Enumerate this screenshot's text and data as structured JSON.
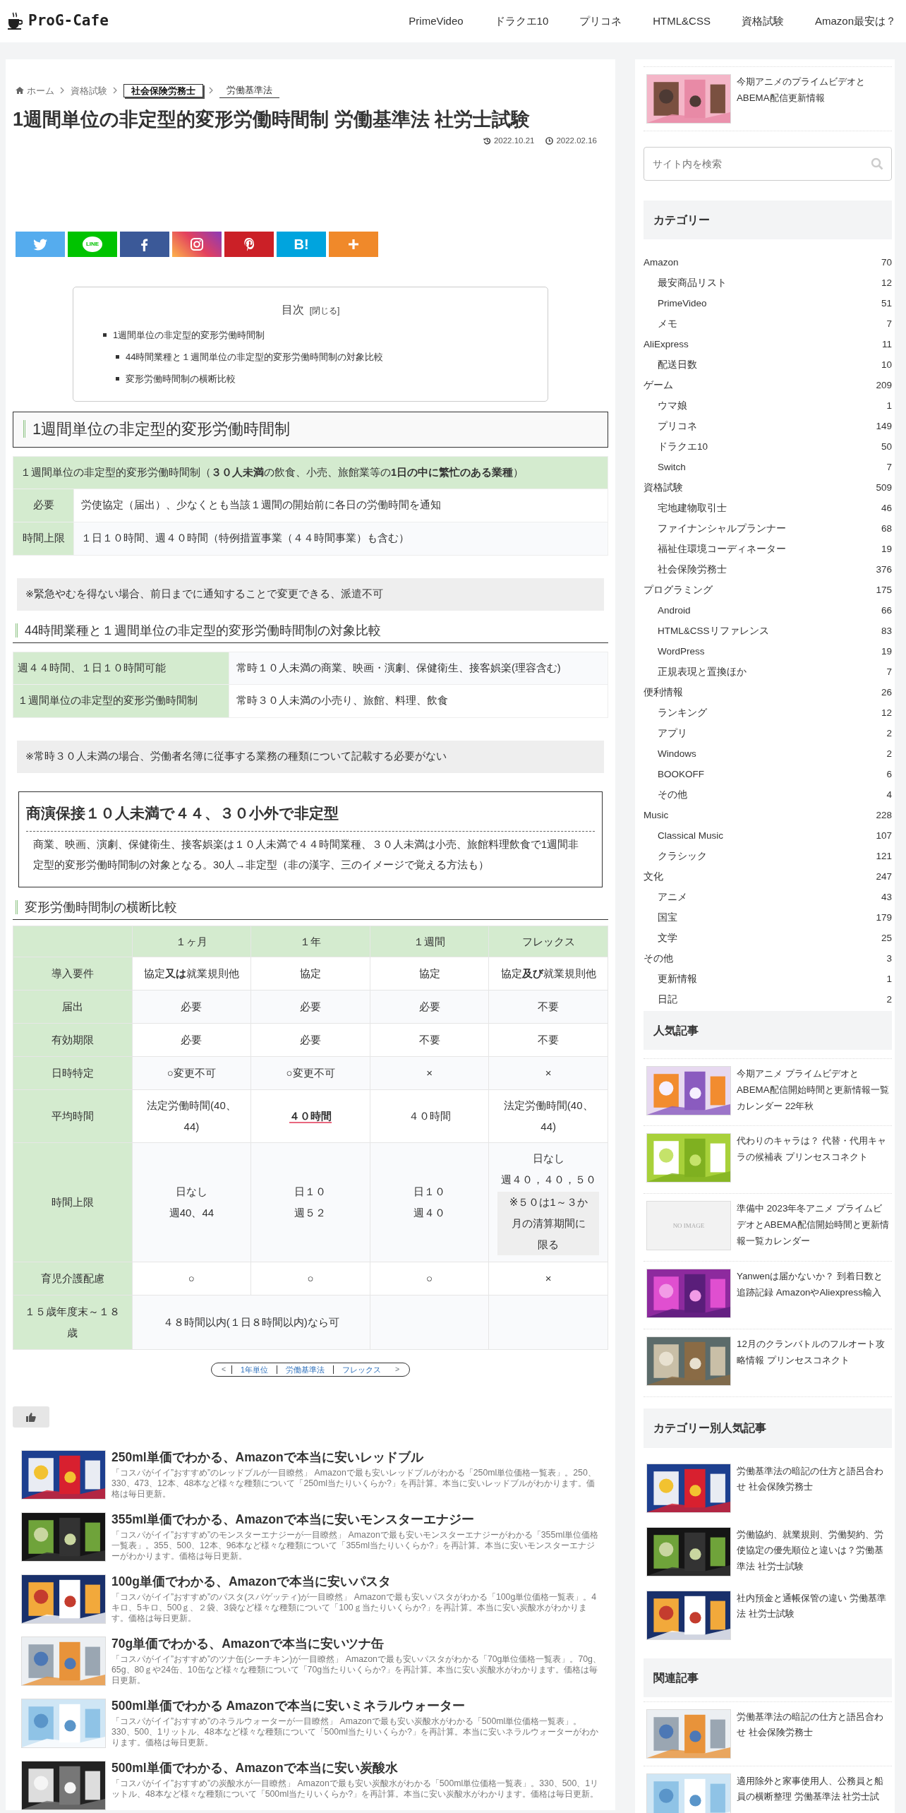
{
  "site": {
    "logo": "ProG-Cafe"
  },
  "nav": [
    "PrimeVideo",
    "ドラクエ10",
    "プリコネ",
    "HTML&CSS",
    "資格試験",
    "Amazon最安は？"
  ],
  "breadcrumb": [
    {
      "label": "ホーム",
      "kind": "home"
    },
    {
      "label": "資格試験",
      "kind": "link"
    },
    {
      "label": "社会保険労務士",
      "kind": "boxed"
    },
    {
      "label": "労働基準法",
      "kind": "underlined"
    }
  ],
  "article": {
    "title": "1週間単位の非定型的変形労働時間制 労働基準法 社労士試験",
    "updated": "2022.10.21",
    "published": "2022.02.16",
    "share_buttons": [
      {
        "kind": "twitter"
      },
      {
        "kind": "line",
        "label": "LINE"
      },
      {
        "kind": "facebook"
      },
      {
        "kind": "instagram"
      },
      {
        "kind": "pinterest"
      },
      {
        "kind": "hatena",
        "label": "B!"
      },
      {
        "kind": "more"
      }
    ],
    "toc": {
      "title": "目次",
      "toggle": "[閉じる]",
      "items": [
        {
          "label": "1週間単位の非定型的変形労働時間制",
          "children": [
            {
              "label": "44時間業種と１週間単位の非定型的変形労働時間制の対象比較"
            },
            {
              "label": "変形労働時間制の横断比較"
            }
          ]
        }
      ]
    },
    "heading": "1週間単位の非定型的変形労働時間制",
    "table_1": {
      "header": "１週間単位の非定型的変形労働時間制（**３０人未満**の飲食、小売、旅館業等の**1日の中に繁忙のある業種**）",
      "rows": [
        {
          "label": "必要",
          "value": "労使協定（届出）、少なくとも当該１週間の開始前に各日の労働時間を通知"
        },
        {
          "label": "時間上限",
          "value": "１日１０時間、週４０時間（特例措置事業（４４時間事業）も含む）"
        }
      ]
    },
    "note_1": "※緊急やむを得ない場合、前日までに通知することで変更できる、派遣不可",
    "subheading_1": "44時間業種と１週間単位の非定型的変形労働時間制の対象比較",
    "table_2": {
      "rows": [
        {
          "label": "週４４時間、１日１０時間可能",
          "value": "常時１０人未満の商業、映画・演劇、保健衛生、接客娯楽(理容含む)"
        },
        {
          "label": "１週間単位の非定型的変形労働時間制",
          "value": "常時３０人未満の小売り、旅館、料理、飲食"
        }
      ]
    },
    "note_2": "※常時３０人未満の場合、労働者名簿に従事する業務の種類について記載する必要がない",
    "memo": {
      "title": "商演保接１０人未満で４４、３０小外で非定型",
      "body": "商業、映画、演劇、保健衛生、接客娯楽は１０人未満で４４時間業種、３０人未満は小売、旅館料理飲食で1週間非定型的変形労働時間制の対象となる。30人→非定型（非の漢字、三のイメージで覚える方法も）"
    },
    "subheading_2": "変形労働時間制の横断比較",
    "table_3": {
      "columns": [
        "１ヶ月",
        "１年",
        "１週間",
        "フレックス"
      ],
      "rows": [
        {
          "label": "導入要件",
          "cells": [
            "協定**又は**就業規則他",
            "協定",
            "協定",
            "協定**及び**就業規則他"
          ]
        },
        {
          "label": "届出",
          "cells": [
            "必要",
            "必要",
            "必要",
            "不要"
          ]
        },
        {
          "label": "有効期限",
          "cells": [
            "必要",
            "必要",
            "不要",
            "不要"
          ]
        },
        {
          "label": "日時特定",
          "cells": [
            "○変更不可",
            "○変更不可",
            "×",
            "×"
          ]
        },
        {
          "label": "平均時間",
          "cells": [
            "法定労働時間(40、44)",
            {
              "text": "４０時間",
              "marker": true
            },
            "４０時間",
            "法定労働時間(40、44)"
          ]
        },
        {
          "label": "時間上限",
          "cells": [
            {
              "lines": [
                "日なし",
                "週40、44"
              ]
            },
            {
              "lines": [
                "日１０",
                "週５２"
              ]
            },
            {
              "lines": [
                "日１０",
                "週４０"
              ]
            },
            {
              "lines": [
                "日なし",
                "週４０，４０，５０"
              ],
              "note": "※５０は1～３か月の清算期間に限る"
            }
          ]
        },
        {
          "label": "育児介護配慮",
          "cells": [
            "○",
            "○",
            "○",
            "×"
          ]
        },
        {
          "label": "１５歳年度末～１８歳",
          "cells": [
            {
              "text": "４８時間以内(１日８時間以内)なら可",
              "colspan": 2
            }
          ]
        }
      ]
    },
    "pager": {
      "prev": "<",
      "links": [
        "1年単位",
        "労働基準法",
        "フレックス"
      ],
      "next": ">"
    },
    "related": [
      {
        "title": "250ml単価でわかる、Amazonで本当に安いレッドブル",
        "excerpt": "「コスパがイイ”おすすめ”のレッドブルが一目瞭然」 Amazonで最も安いレッドブルがわかる「250ml単位価格一覧表」。250、330、473、12本、48本など様々な種類について「250ml当たりいくらか?」を再計算。本当に安いレッドブルがわかります。価格は毎日更新。"
      },
      {
        "title": "355ml単価でわかる、Amazonで本当に安いモンスターエナジー",
        "excerpt": "「コスパがイイ”おすすめ”のモンスターエナジーが一目瞭然」 Amazonで最も安いモンスターエナジーがわかる「355ml単位価格一覧表」。355、500、12本、96本など様々な種類について「355ml当たりいくらか?」を再計算。本当に安いモンスターエナジーがわかります。価格は毎日更新。"
      },
      {
        "title": "100g単価でわかる、Amazonで本当に安いパスタ",
        "excerpt": "「コスパがイイ”おすすめ”のパスタ(スパゲッティ)が一目瞭然」 Amazonで最も安いパスタがわかる「100g単位価格一覧表」。4キロ、5キロ、500ｇ、２袋、3袋など様々な種類について「100ｇ当たりいくらか?」を再計算。本当に安い炭酸水がわかります。価格は毎日更新。"
      },
      {
        "title": "70g単価でわかる、Amazonで本当に安いツナ缶",
        "excerpt": "「コスパがイイ”おすすめ”のツナ缶(シーチキン)が一目瞭然」 Amazonで最も安いパスタがわかる「70g単位価格一覧表」。70g、65g、80ｇや24缶、10缶など様々な種類について「70g当たりいくらか?」を再計算。本当に安い炭酸水がわかります。価格は毎日更新。"
      },
      {
        "title": "500ml単価でわかる Amazonで本当に安いミネラルウォーター",
        "excerpt": "「コスパがイイ”おすすめ”のネラルウォーターが一目瞭然」 Amazonで最も安い炭酸水がわかる「500ml単位価格一覧表」。330、500、1リットル、48本など様々な種類について「500ml当たりいくらか?」を再計算。本当に安いネラルウォーターがわかります。価格は毎日更新。"
      },
      {
        "title": "500ml単価でわかる、Amazonで本当に安い炭酸水",
        "excerpt": "「コスパがイイ”おすすめ”の炭酸水が一目瞭然」 Amazonで最も安い炭酸水がわかる「500ml単位価格一覧表」。330、500、1リットル、48本など様々な種類について「500ml当たりいくらか?」を再計算。本当に安い炭酸水がわかります。価格は毎日更新。"
      }
    ]
  },
  "sidebar": {
    "top_post": {
      "title": "今期アニメのプライムビデオとABEMA配信更新情報"
    },
    "search": {
      "placeholder": "サイト内を検索"
    },
    "categories_title": "カテゴリー",
    "categories": [
      {
        "name": "Amazon",
        "count": "70",
        "children": [
          {
            "name": "最安商品リスト",
            "count": "12"
          },
          {
            "name": "PrimeVideo",
            "count": "51"
          },
          {
            "name": "メモ",
            "count": "7"
          }
        ]
      },
      {
        "name": "AliExpress",
        "count": "11",
        "children": [
          {
            "name": "配送日数",
            "count": "10"
          }
        ]
      },
      {
        "name": "ゲーム",
        "count": "209",
        "children": [
          {
            "name": "ウマ娘",
            "count": "1"
          },
          {
            "name": "プリコネ",
            "count": "149"
          },
          {
            "name": "ドラクエ10",
            "count": "50"
          },
          {
            "name": "Switch",
            "count": "7"
          }
        ]
      },
      {
        "name": "資格試験",
        "count": "509",
        "children": [
          {
            "name": "宅地建物取引士",
            "count": "46"
          },
          {
            "name": "ファイナンシャルプランナー",
            "count": "68"
          },
          {
            "name": "福祉住環境コーディネーター",
            "count": "19"
          },
          {
            "name": "社会保険労務士",
            "count": "376"
          }
        ]
      },
      {
        "name": "プログラミング",
        "count": "175",
        "children": [
          {
            "name": "Android",
            "count": "66"
          },
          {
            "name": "HTML&CSSリファレンス",
            "count": "83"
          },
          {
            "name": "WordPress",
            "count": "19"
          },
          {
            "name": "正規表現と置換ほか",
            "count": "7"
          }
        ]
      },
      {
        "name": "便利情報",
        "count": "26",
        "children": [
          {
            "name": "ランキング",
            "count": "12"
          },
          {
            "name": "アプリ",
            "count": "2"
          },
          {
            "name": "Windows",
            "count": "2"
          },
          {
            "name": "BOOKOFF",
            "count": "6"
          },
          {
            "name": "その他",
            "count": "4"
          }
        ]
      },
      {
        "name": "Music",
        "count": "228",
        "children": [
          {
            "name": "Classical Music",
            "count": "107"
          },
          {
            "name": "クラシック",
            "count": "121"
          }
        ]
      },
      {
        "name": "文化",
        "count": "247",
        "children": [
          {
            "name": "アニメ",
            "count": "43"
          },
          {
            "name": "国宝",
            "count": "179"
          },
          {
            "name": "文学",
            "count": "25"
          }
        ]
      },
      {
        "name": "その他",
        "count": "3",
        "children": [
          {
            "name": "更新情報",
            "count": "1"
          },
          {
            "name": "日記",
            "count": "2"
          }
        ]
      }
    ],
    "widgets": [
      {
        "title": "人気記事",
        "posts": [
          {
            "title": "今期アニメ プライムビデオとABEMA配信開始時間と更新情報一覧カレンダー 22年秋"
          },
          {
            "title": "代わりのキャラは？ 代替・代用キャラの候補表 プリンセスコネクト"
          },
          {
            "title": "準備中 2023年冬アニメ プライムビデオとABEMA配信開始時間と更新情報一覧カレンダー",
            "thumb": {
              "kind": "placeholder",
              "label": "NO IMAGE"
            }
          },
          {
            "title": "Yanwenは届かないか？ 到着日数と追跡記録 AmazonやAliexpress輸入"
          },
          {
            "title": "12月のクランバトルのフルオート攻略情報 プリンセスコネクト"
          }
        ]
      },
      {
        "title": "カテゴリー別人気記事",
        "posts": [
          {
            "title": "労働基準法の暗記の仕方と語呂合わせ 社会保険労務士"
          },
          {
            "title": "労働協約、就業規則、労働契約、労使協定の優先順位と違いは？労働基準法 社労士試験"
          },
          {
            "title": "社内預金と通帳保管の違い 労働基準法 社労士試験"
          }
        ]
      },
      {
        "title": "関連記事",
        "posts": [
          {
            "title": "労働基準法の暗記の仕方と語呂合わせ 社会保険労務士"
          },
          {
            "title": "適用除外と家事使用人、公務員と船員の横断整理 労働基準法 社労士試"
          }
        ]
      }
    ]
  }
}
